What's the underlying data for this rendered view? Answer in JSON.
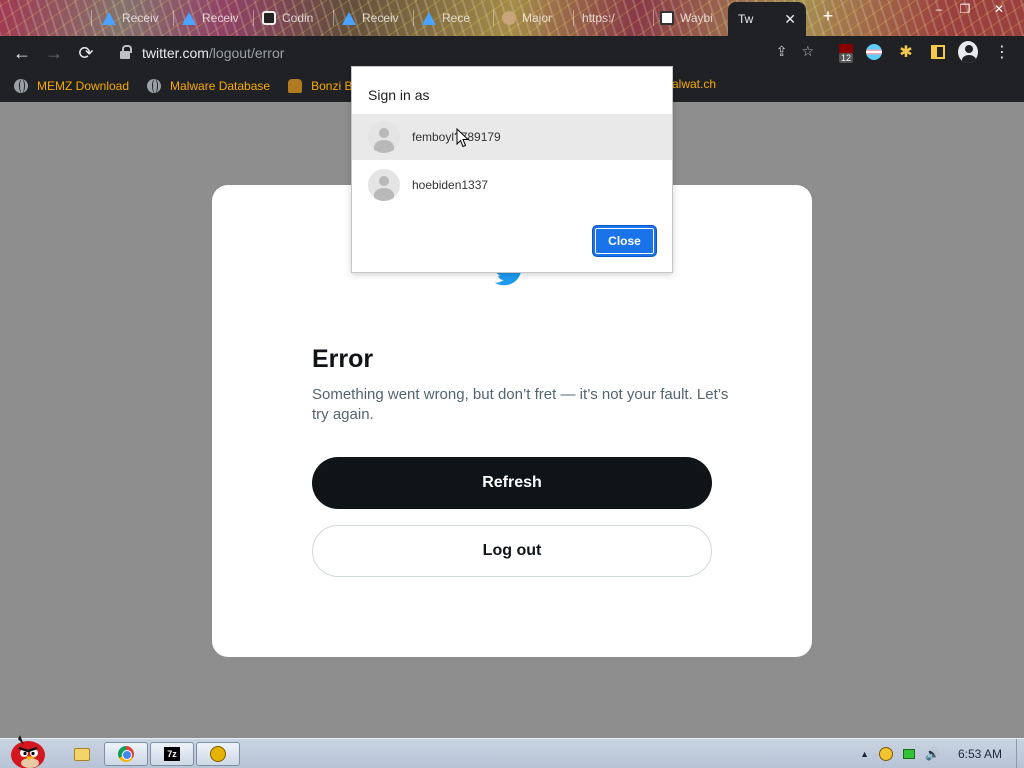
{
  "browser": {
    "tabs": [
      {
        "label": "",
        "icon": "twitter-bird-icon"
      },
      {
        "label": "Receiv",
        "icon": "triangle-icon"
      },
      {
        "label": "Receiv",
        "icon": "triangle-icon"
      },
      {
        "label": "Codin",
        "icon": "code-icon"
      },
      {
        "label": "Receiv",
        "icon": "triangle-icon"
      },
      {
        "label": "Rece",
        "icon": "triangle-icon"
      },
      {
        "label": "Major",
        "icon": "major-icon"
      },
      {
        "label": "https:/",
        "icon": "twitter-bird-icon"
      },
      {
        "label": "Waybi",
        "icon": "wayback-icon"
      }
    ],
    "active_tab": {
      "label": "Tw",
      "close": "✕"
    },
    "new_tab": "+",
    "window_controls": {
      "minimize": "–",
      "restore": "❐",
      "close": "✕"
    },
    "nav": {
      "back": "←",
      "forward": "→",
      "reload": "⟳"
    },
    "url": {
      "host": "twitter.com",
      "path": "/logout/error"
    },
    "omnibox_icons": {
      "share": "⇪",
      "star": "☆"
    },
    "extensions": {
      "ublock_count": "12",
      "menu": "⋮",
      "puzzle": "✱"
    },
    "bookmarks": [
      {
        "label": "MEMZ Download",
        "icon": "globe-icon"
      },
      {
        "label": "Malware Database",
        "icon": "globe-icon"
      },
      {
        "label": "Bonzi BU",
        "icon": "bonzi-icon"
      }
    ],
    "bookmark_right": "malwat.ch"
  },
  "page": {
    "title": "Error",
    "message": "Something went wrong, but don’t fret — it’s not your fault. Let’s try again.",
    "refresh_label": "Refresh",
    "logout_label": "Log out"
  },
  "signin_popup": {
    "title": "Sign in as",
    "accounts": [
      {
        "name": "femboyl?789179"
      },
      {
        "name": "hoebiden1337"
      }
    ],
    "close_label": "Close"
  },
  "taskbar": {
    "clock": "6:53 AM",
    "tray_arrow": "▲",
    "volume": "🔊"
  },
  "colors": {
    "twitter_blue": "#1d9bf0",
    "button_dark": "#0f1419",
    "close_button": "#1a73e8",
    "bookmark_text": "#f9ab00"
  }
}
